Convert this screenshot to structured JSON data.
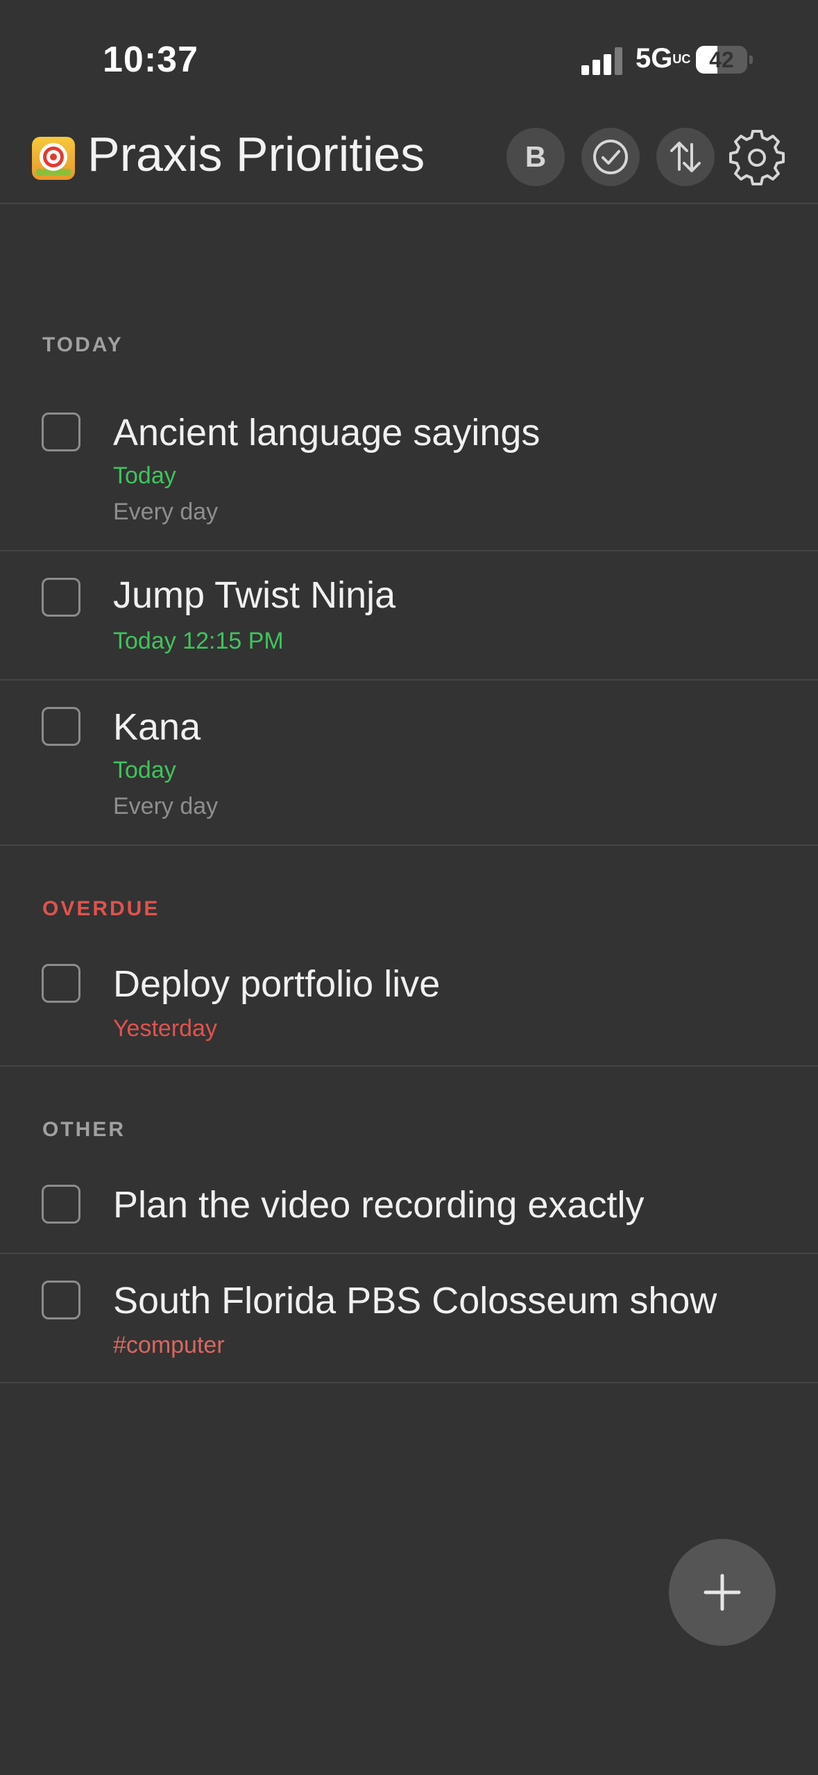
{
  "status_bar": {
    "time": "10:37",
    "network": "5G",
    "network_suffix": "UC",
    "battery": "42",
    "battery_level": 0.42
  },
  "header": {
    "title": "Praxis Priorities",
    "avatar_initial": "B",
    "icons": [
      "target-icon",
      "check-circle-icon",
      "sort-arrows-icon",
      "gear-icon"
    ]
  },
  "sections": {
    "today": {
      "label": "TODAY",
      "tasks": [
        {
          "title": "Ancient language sayings",
          "due": "Today",
          "repeat": "Every day"
        },
        {
          "title": "Jump Twist Ninja",
          "due": "Today 12:15 PM"
        },
        {
          "title": "Kana",
          "due": "Today",
          "repeat": "Every day"
        }
      ]
    },
    "overdue": {
      "label": "OVERDUE",
      "tasks": [
        {
          "title": "Deploy portfolio live",
          "due": "Yesterday"
        }
      ]
    },
    "other": {
      "label": "OTHER",
      "tasks": [
        {
          "title": "Plan the video recording exactly"
        },
        {
          "title": "South Florida PBS Colosseum show",
          "tag": "#computer"
        }
      ]
    }
  },
  "colors": {
    "background": "#333333",
    "due_today": "#3fc45c",
    "overdue": "#e0534e",
    "tag": "#d9675f"
  }
}
